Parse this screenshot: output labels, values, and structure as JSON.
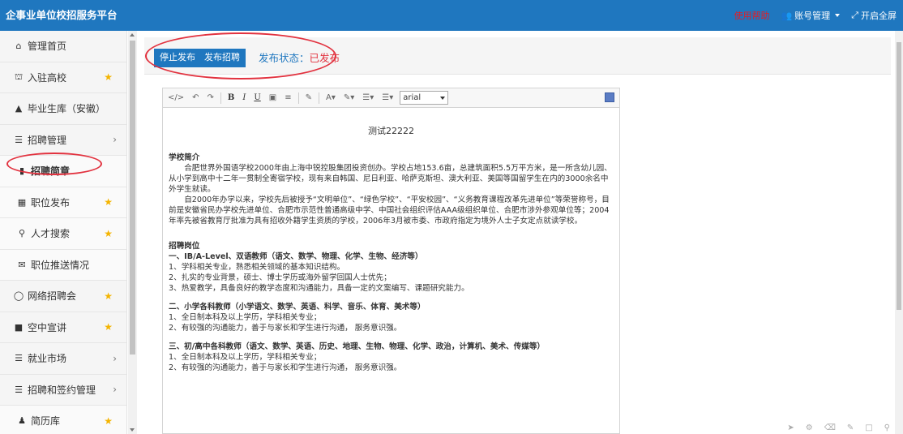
{
  "app": {
    "title": "企事业单位校招服务平台"
  },
  "topnav": {
    "help": "使用帮助",
    "account": "账号管理",
    "fullscreen": "开启全屏"
  },
  "sidebar": {
    "items": [
      {
        "label": "管理首页",
        "icon": "home-icon",
        "star": false,
        "arrow": false
      },
      {
        "label": "入驻高校",
        "icon": "bank-icon",
        "star": true,
        "arrow": false
      },
      {
        "label": "毕业生库（安徽）",
        "icon": "graduation-cap-icon",
        "star": false,
        "arrow": false
      },
      {
        "label": "招聘管理",
        "icon": "list-icon",
        "star": false,
        "arrow": true
      },
      {
        "label": "招聘简章",
        "icon": "document-icon",
        "star": false,
        "arrow": false,
        "sub": true,
        "active": true
      },
      {
        "label": "职位发布",
        "icon": "grid-icon",
        "star": true,
        "arrow": false,
        "sub": true
      },
      {
        "label": "人才搜索",
        "icon": "search-icon",
        "star": true,
        "arrow": false,
        "sub": true
      },
      {
        "label": "职位推送情况",
        "icon": "mail-icon",
        "star": false,
        "arrow": false,
        "sub": true
      },
      {
        "label": "网络招聘会",
        "icon": "browser-icon",
        "star": true,
        "arrow": false
      },
      {
        "label": "空中宣讲",
        "icon": "video-icon",
        "star": true,
        "arrow": false
      },
      {
        "label": "就业市场",
        "icon": "list-icon",
        "star": false,
        "arrow": true
      },
      {
        "label": "招聘和签约管理",
        "icon": "list-icon",
        "star": false,
        "arrow": true
      },
      {
        "label": "简历库",
        "icon": "users-icon",
        "star": true,
        "arrow": false,
        "sub": true
      }
    ]
  },
  "toolbar": {
    "stop_label": "停止发布",
    "publish_label": "发布招聘",
    "status_label": "发布状态：",
    "status_value": "已发布"
  },
  "editor": {
    "font": "arial",
    "title": "测试22222",
    "section1_heading": "学校简介",
    "para1": "合肥世界外国语学校2000年由上海中锐控股集团投资创办。学校占地153.6亩，总建筑面积5.5万平方米，是一所含幼儿园、从小学到高中十二年一贯制全寄宿学校，现有来自韩国、尼日利亚、哈萨克斯坦、澳大利亚、美国等国留学生在内的3000余名中外学生就读。",
    "para2": "自2000年办学以来，学校先后被授予“文明单位”、“绿色学校”、“平安校园”、“义务教育课程改革先进单位”等荣誉称号，目前是安徽省民办学校先进单位、合肥市示范性普通高级中学、中国社会组织评估AAA级组织单位、合肥市涉外参观单位等；2004年率先被省教育厅批准为具有招收外籍学生资质的学校，2006年3月被市委、市政府指定为境外人士子女定点就读学校。",
    "section2_heading": "招聘岗位",
    "job1_title": "一、IB/A-Level、双语教师（语文、数学、物理、化学、生物、经济等）",
    "job1_l1": "1、学科相关专业，熟悉相关领域的基本知识结构。",
    "job1_l2": "2、扎实的专业背景，硕士、博士学历或海外留学回国人士优先；",
    "job1_l3": "3、热爱教学，具备良好的教学态度和沟通能力，具备一定的文案编写、课题研究能力。",
    "job2_title": "二、小学各科教师（小学语文、数学、英语、科学、音乐、体育、美术等）",
    "job2_l1": "1、全日制本科及以上学历，学科相关专业；",
    "job2_l2": "2、有较强的沟通能力，善于与家长和学生进行沟通， 服务意识强。",
    "job3_title": "三、初/高中各科教师（语文、数学、英语、历史、地理、生物、物理、化学、政治，计算机、美术、传媒等）",
    "job3_l1": "1、全日制本科及以上学历，学科相关专业；",
    "job3_l2": "2、有较强的沟通能力，善于与家长和学生进行沟通， 服务意识强。"
  },
  "colors": {
    "brand": "#1f77bf",
    "highlight": "#e2323f",
    "star": "#f4b400"
  }
}
